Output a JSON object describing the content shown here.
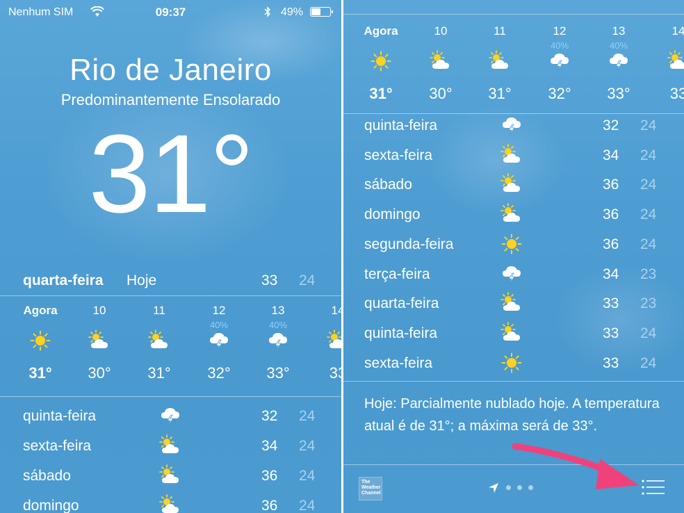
{
  "status": {
    "carrier": "Nenhum SIM",
    "time": "09:37",
    "battery": "49%",
    "battery_level": 0.49,
    "icons": [
      "wifi-icon",
      "bluetooth-icon",
      "battery-icon"
    ]
  },
  "location": {
    "city": "Rio de Janeiro",
    "condition": "Predominantemente Ensolarado",
    "current_temp": "31°"
  },
  "today": {
    "day": "quarta-feira",
    "label": "Hoje",
    "high": "33",
    "low": "24"
  },
  "hourly": [
    {
      "label": "Agora",
      "pct": "",
      "icon": "sun-icon",
      "temp": "31°"
    },
    {
      "label": "10",
      "pct": "",
      "icon": "partly-cloudy-icon",
      "temp": "30°"
    },
    {
      "label": "11",
      "pct": "",
      "icon": "partly-cloudy-icon",
      "temp": "31°"
    },
    {
      "label": "12",
      "pct": "40%",
      "icon": "thunderstorm-icon",
      "temp": "32°"
    },
    {
      "label": "13",
      "pct": "40%",
      "icon": "thunderstorm-icon",
      "temp": "33°"
    },
    {
      "label": "14",
      "pct": "",
      "icon": "partly-cloudy-icon",
      "temp": "33"
    }
  ],
  "daily": [
    {
      "day": "quinta-feira",
      "icon": "thunderstorm-icon",
      "high": "32",
      "low": "24"
    },
    {
      "day": "sexta-feira",
      "icon": "partly-cloudy-icon",
      "high": "34",
      "low": "24"
    },
    {
      "day": "sábado",
      "icon": "partly-cloudy-icon",
      "high": "36",
      "low": "24"
    },
    {
      "day": "domingo",
      "icon": "partly-cloudy-icon",
      "high": "36",
      "low": "24"
    },
    {
      "day": "segunda-feira",
      "icon": "sun-icon",
      "high": "36",
      "low": "24"
    },
    {
      "day": "terça-feira",
      "icon": "thunderstorm-icon",
      "high": "34",
      "low": "23"
    },
    {
      "day": "quarta-feira",
      "icon": "partly-cloudy-icon",
      "high": "33",
      "low": "23"
    },
    {
      "day": "quinta-feira",
      "icon": "partly-cloudy-icon",
      "high": "33",
      "low": "24"
    },
    {
      "day": "sexta-feira",
      "icon": "sun-icon",
      "high": "33",
      "low": "24"
    }
  ],
  "summary": "Hoje: Parcialmente nublado hoje. A temperatura atual é de 31°; a máxima será de 33°.",
  "footer": {
    "logo_text": "The Weather Channel",
    "page_dots": 3
  },
  "colors": {
    "background": "#4f9ed3",
    "low_temp": "#a9d2ee",
    "precip": "#8fd0ff",
    "sun": "#ffd21f",
    "annotation_arrow": "#f0427a"
  }
}
